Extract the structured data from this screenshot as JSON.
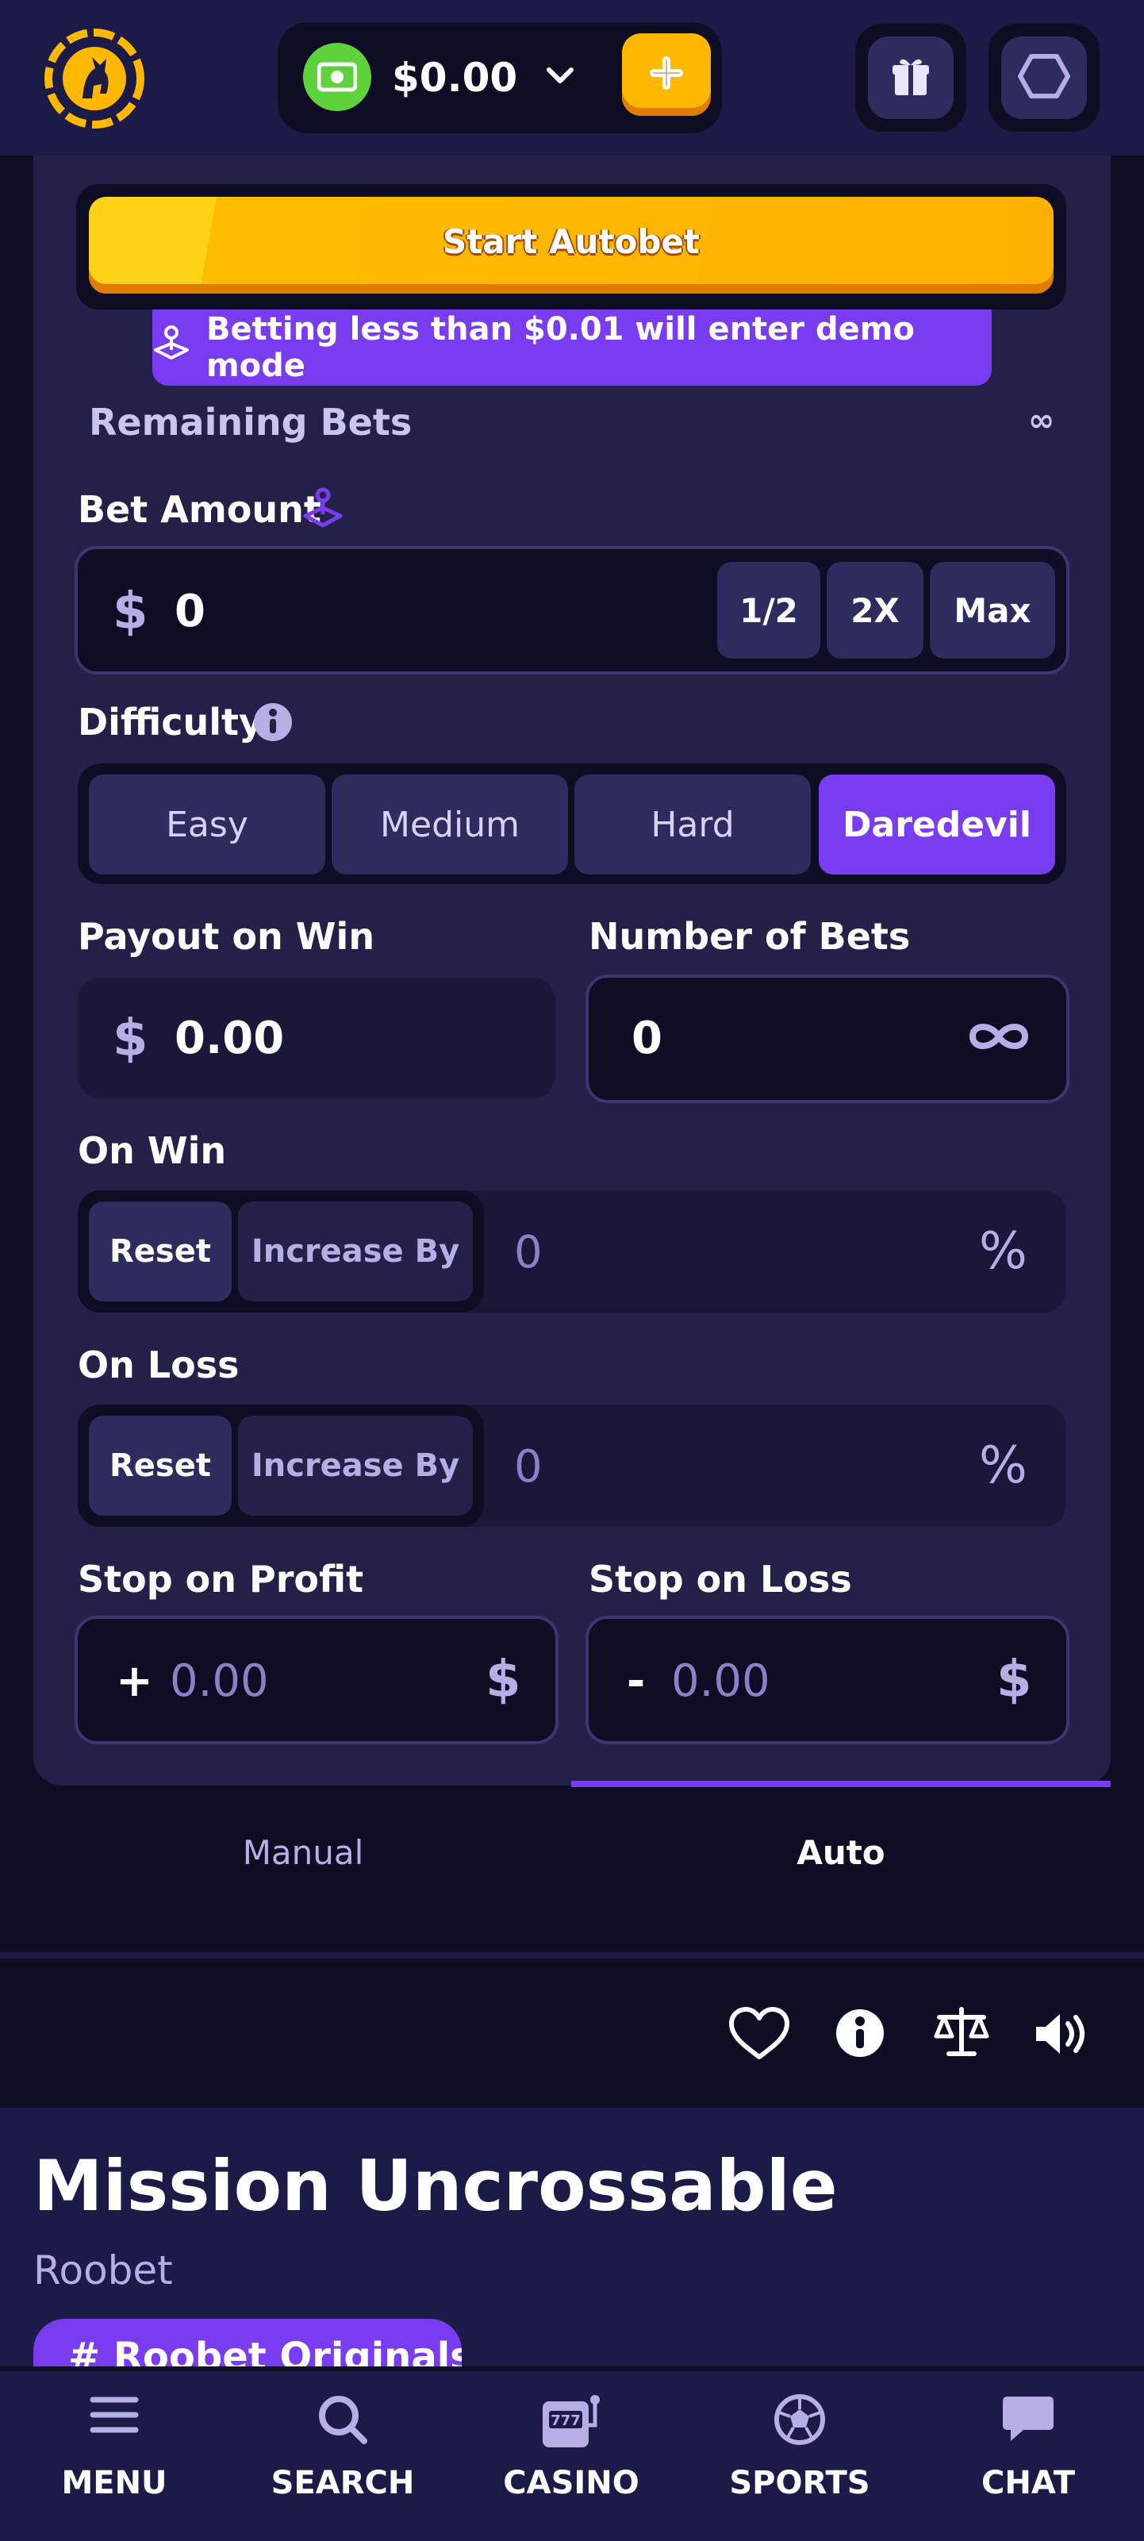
{
  "header": {
    "balance": "$0.00"
  },
  "autobet": {
    "start_label": "Start Autobet",
    "demo_notice": "Betting less than $0.01 will enter demo mode",
    "remaining_bets_label": "Remaining Bets",
    "remaining_bets_value": "∞"
  },
  "bet_amount": {
    "label": "Bet Amount",
    "currency": "$",
    "value": "0",
    "half_label": "1/2",
    "double_label": "2X",
    "max_label": "Max"
  },
  "difficulty": {
    "label": "Difficulty",
    "options": [
      "Easy",
      "Medium",
      "Hard",
      "Daredevil"
    ],
    "selected": "Daredevil"
  },
  "payout": {
    "label": "Payout on Win",
    "currency": "$",
    "value": "0.00"
  },
  "number_of_bets": {
    "label": "Number of Bets",
    "value": "0"
  },
  "on_win": {
    "label": "On Win",
    "reset_label": "Reset",
    "increase_label": "Increase By",
    "value": "0",
    "unit": "%"
  },
  "on_loss": {
    "label": "On Loss",
    "reset_label": "Reset",
    "increase_label": "Increase By",
    "value": "0",
    "unit": "%"
  },
  "stop_profit": {
    "label": "Stop on Profit",
    "sign": "+",
    "value": "0.00",
    "currency": "$"
  },
  "stop_loss": {
    "label": "Stop on Loss",
    "sign": "-",
    "value": "0.00",
    "currency": "$"
  },
  "tabs": {
    "manual": "Manual",
    "auto": "Auto",
    "active": "Auto"
  },
  "game": {
    "title": "Mission Uncrossable",
    "provider": "Roobet",
    "tag": "# Roobet Originals"
  },
  "nav": {
    "menu": "MENU",
    "search": "SEARCH",
    "casino": "CASINO",
    "sports": "SPORTS",
    "chat": "CHAT"
  },
  "colors": {
    "background": "#0d0e24",
    "panel": "#242149",
    "accent_purple": "#7a3cf0",
    "accent_yellow": "#ffb800",
    "wallet_green": "#5ed23a"
  },
  "icons": [
    "kangaroo-logo-icon",
    "cash-icon",
    "chevron-down-icon",
    "plus-icon",
    "gift-icon",
    "hexagon-icon",
    "joystick-icon",
    "info-icon",
    "infinity-icon",
    "heart-icon",
    "scale-icon",
    "volume-icon",
    "menu-icon",
    "search-icon",
    "slot-machine-icon",
    "soccer-ball-icon",
    "chat-bubble-icon"
  ]
}
